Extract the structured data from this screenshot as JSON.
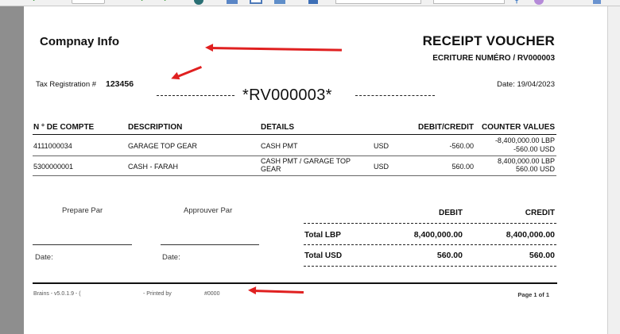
{
  "toolbar": {
    "icons": [
      "check-icon",
      "check-icon",
      "check-icon",
      "refresh-icon",
      "save-icon",
      "print-preview-icon",
      "print-icon",
      "export-icon",
      "search-icon",
      "help-icon",
      "window-icon"
    ]
  },
  "company": {
    "info": "Compnay Info"
  },
  "header": {
    "title": "RECEIPT VOUCHER",
    "subtitle": "ECRITURE NUMÉRO / RV000003",
    "tax_label": "Tax Registration #",
    "tax_value": "123456",
    "date_label": "Date:  19/04/2023",
    "voucher_code": "*RV000003*"
  },
  "table": {
    "columns": [
      "N ° DE COMPTE",
      "DESCRIPTION",
      "DETAILS",
      "DEBIT/CREDIT",
      "COUNTER VALUES"
    ],
    "rows": [
      {
        "account": "4111000034",
        "description": "GARAGE TOP GEAR",
        "details": "CASH PMT",
        "currency": "USD",
        "amount": "-560.00",
        "counter_1": "-8,400,000.00 LBP",
        "counter_2": "-560.00 USD"
      },
      {
        "account": "5300000001",
        "description": "CASH - FARAH",
        "details_1": "CASH PMT / GARAGE TOP",
        "details_2": "GEAR",
        "currency": "USD",
        "amount": "560.00",
        "counter_1": "8,400,000.00 LBP",
        "counter_2": "560.00 USD"
      }
    ]
  },
  "signatures": {
    "prepared": "Prepare Par",
    "approved": "Approuver Par",
    "date_label": "Date:"
  },
  "totals": {
    "debit_header": "DEBIT",
    "credit_header": "CREDIT",
    "lbp_label": "Total LBP",
    "lbp_debit": "8,400,000.00",
    "lbp_credit": "8,400,000.00",
    "usd_label": "Total USD",
    "usd_debit": "560.00",
    "usd_credit": "560.00"
  },
  "footer": {
    "version": "Brains - v5.0.1.9 - (",
    "printed_by": "- Printed by",
    "code": "#0000",
    "page": "Page 1 of 1"
  },
  "colors": {
    "annotation_arrow": "#e02020",
    "page": "#ffffff",
    "background": "#9b9b9b"
  }
}
